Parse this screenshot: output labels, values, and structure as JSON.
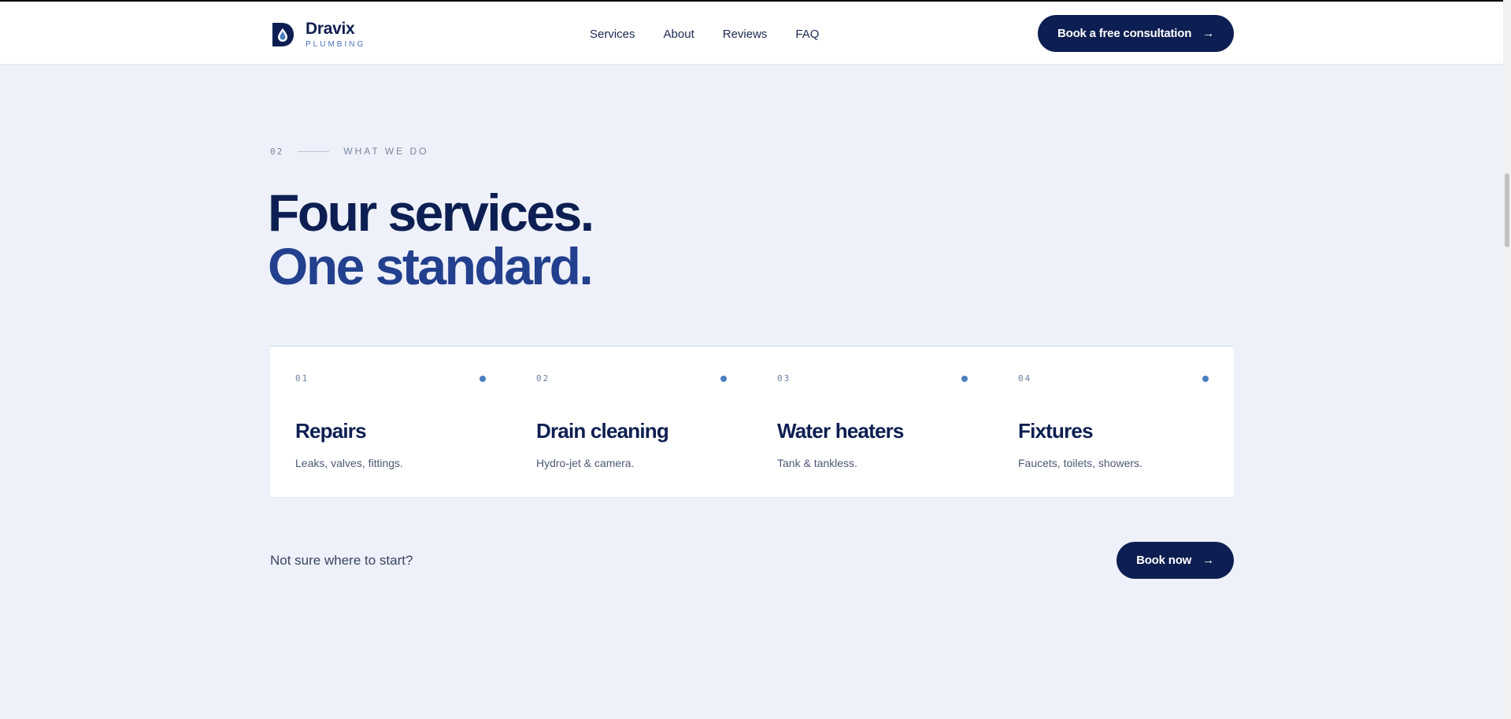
{
  "header": {
    "logo_name": "Dravix",
    "logo_sub": "PLUMBING",
    "nav": [
      "Services",
      "About",
      "Reviews",
      "FAQ"
    ],
    "cta_label": "Book a free consultation",
    "cta_arrow": "→"
  },
  "section": {
    "eyebrow_num": "02",
    "eyebrow_label": "WHAT WE DO",
    "headline_line1": "Four services.",
    "headline_line2": "One standard."
  },
  "services": [
    {
      "num": "01",
      "title": "Repairs",
      "desc": "Leaks, valves, fittings."
    },
    {
      "num": "02",
      "title": "Drain cleaning",
      "desc": "Hydro-jet & camera."
    },
    {
      "num": "03",
      "title": "Water heaters",
      "desc": "Tank & tankless."
    },
    {
      "num": "04",
      "title": "Fixtures",
      "desc": "Faucets, toilets, showers."
    }
  ],
  "cta": {
    "prompt": "Not sure where to start?",
    "button_label": "Book now",
    "button_arrow": "→"
  },
  "colors": {
    "brand_navy": "#0d1f52",
    "accent_blue": "#23408e",
    "dot_blue": "#4a7fc0",
    "page_bg": "#eef1f9"
  }
}
